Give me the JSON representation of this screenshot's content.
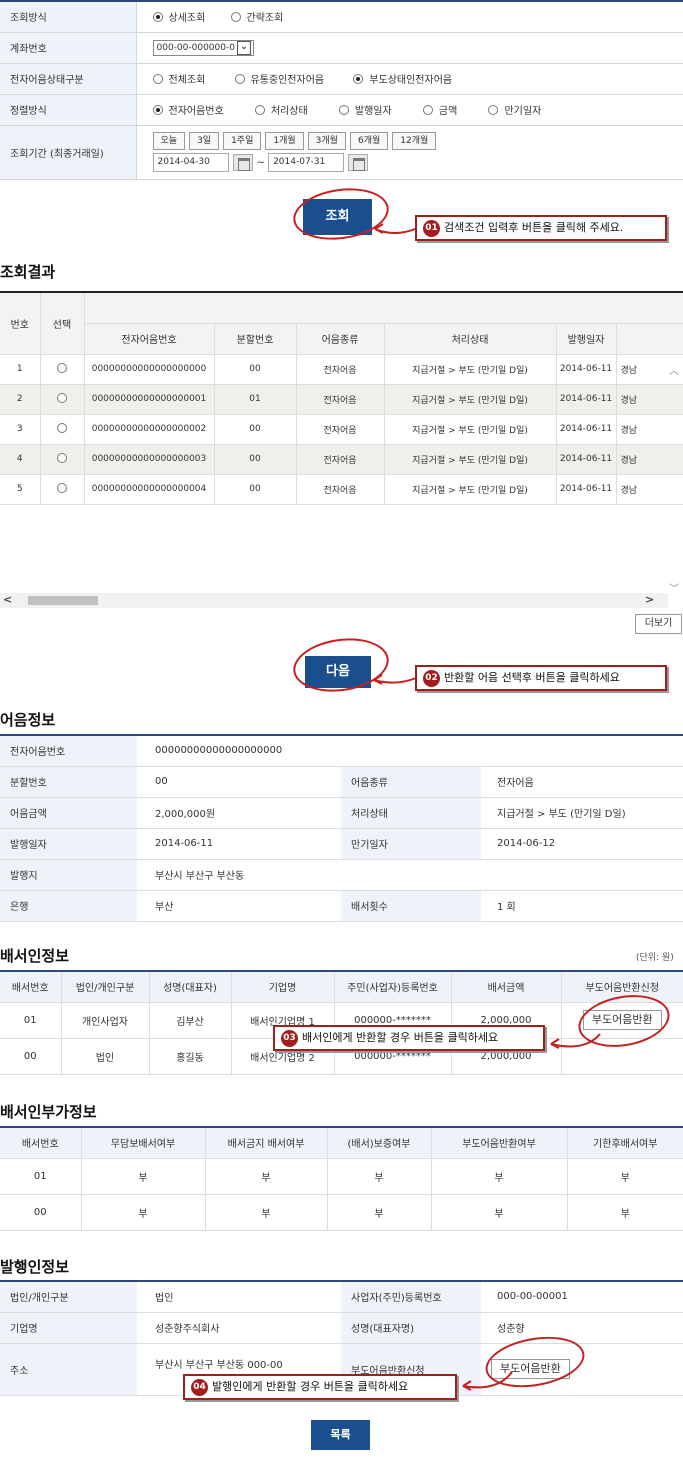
{
  "search_form": {
    "rows": [
      {
        "label": "조회방식",
        "options": [
          "상세조회",
          "간략조회"
        ],
        "selected": 0
      },
      {
        "label": "계좌번호",
        "account_value": "000-00-000000-0"
      },
      {
        "label": "전자어음상태구분",
        "options": [
          "전체조회",
          "유통중인전자어음",
          "부도상태인전자어음"
        ],
        "selected": 2
      },
      {
        "label": "정렬방식",
        "options": [
          "전자어음번호",
          "처리상태",
          "발행일자",
          "금액",
          "만기일자"
        ],
        "selected": 0
      },
      {
        "label": "조회기간 (최종거래일)",
        "periods": [
          "오늘",
          "3일",
          "1주일",
          "1개월",
          "3개월",
          "6개월",
          "12개월"
        ],
        "date_from": "2014-04-30",
        "date_sep": "~",
        "date_to": "2014-07-31"
      }
    ]
  },
  "search_button": "조회",
  "callouts": {
    "c1": {
      "num": "01",
      "text": "검색조건 입력후 버튼을 클릭해 주세요."
    },
    "c2": {
      "num": "02",
      "text": "반환할 어음 선택후 버튼을 클릭하세요"
    },
    "c3": {
      "num": "03",
      "text": "배서인에게 반환할 경우 버튼을 클릭하세요"
    },
    "c4": {
      "num": "04",
      "text": "발행인에게 반환할 경우 버튼을 클릭하세요"
    }
  },
  "results": {
    "title": "조회결과",
    "headers": [
      "번호",
      "선택",
      "전자어음번호",
      "분할번호",
      "어음종류",
      "처리상태",
      "발행일자"
    ],
    "rows": [
      {
        "no": "1",
        "note": "00000000000000000000",
        "split": "00",
        "kind": "전자어음",
        "status": "지급거절 > 부도 (만기일 D일)",
        "date": "2014-06-11",
        "extra": "경남"
      },
      {
        "no": "2",
        "note": "00000000000000000001",
        "split": "01",
        "kind": "전자어음",
        "status": "지급거절 > 부도 (만기일 D일)",
        "date": "2014-06-11",
        "extra": "경남"
      },
      {
        "no": "3",
        "note": "00000000000000000002",
        "split": "00",
        "kind": "전자어음",
        "status": "지급거절 > 부도 (만기일 D일)",
        "date": "2014-06-11",
        "extra": "경남"
      },
      {
        "no": "4",
        "note": "00000000000000000003",
        "split": "00",
        "kind": "전자어음",
        "status": "지급거절 > 부도 (만기일 D일)",
        "date": "2014-06-11",
        "extra": "경남"
      },
      {
        "no": "5",
        "note": "00000000000000000004",
        "split": "00",
        "kind": "전자어음",
        "status": "지급거절 > 부도 (만기일 D일)",
        "date": "2014-06-11",
        "extra": "경남"
      }
    ],
    "more_button": "더보기"
  },
  "next_button": "다음",
  "note_info": {
    "title": "어음정보",
    "note_no_label": "전자어음번호",
    "note_no": "00000000000000000000",
    "split_label": "분할번호",
    "split": "00",
    "kind_label": "어음종류",
    "kind": "전자어음",
    "amount_label": "어음금액",
    "amount": "2,000,000원",
    "status_label": "처리상태",
    "status": "지급거절 > 부도 (만기일 D일)",
    "issue_label": "발행일자",
    "issue": "2014-06-11",
    "due_label": "만기일자",
    "due": "2014-06-12",
    "place_label": "발행지",
    "place": "부산시 부산구 부산동",
    "bank_label": "은행",
    "bank": "부산",
    "endorse_count_label": "배서횟수",
    "endorse_count": "1 회"
  },
  "endorser_info": {
    "title": "배서인정보",
    "unit": "(단위: 원)",
    "headers": [
      "배서번호",
      "법인/개인구분",
      "성명(대표자)",
      "기업명",
      "주민(사업자)등록번호",
      "배서금액",
      "부도어음반환신청"
    ],
    "rows": [
      {
        "no": "01",
        "type": "개인사업자",
        "name": "김부산",
        "company": "배서인기업명 1",
        "reg": "000000-*******",
        "amount": "2,000,000",
        "action": "부도어음반환"
      },
      {
        "no": "00",
        "type": "법인",
        "name": "홍길동",
        "company": "배서인기업명 2",
        "reg": "000000-*******",
        "amount": "2,000,000",
        "action": ""
      }
    ]
  },
  "endorser_extra": {
    "title": "배서인부가정보",
    "headers": [
      "배서번호",
      "무담보배서여부",
      "배서금지 배서여부",
      "(배서)보증여부",
      "부도어음반환여부",
      "기한후배서여부"
    ],
    "rows": [
      [
        "01",
        "부",
        "부",
        "부",
        "부",
        "부"
      ],
      [
        "00",
        "부",
        "부",
        "부",
        "부",
        "부"
      ]
    ]
  },
  "issuer_info": {
    "title": "발행인정보",
    "type_label": "법인/개인구분",
    "type": "법인",
    "reg_label": "사업자(주민)등록번호",
    "reg": "000-00-00001",
    "company_label": "기업명",
    "company": "성춘향주식회사",
    "name_label": "성명(대표자명)",
    "name": "성춘향",
    "addr_label": "주소",
    "addr": "부산시 부산구 부산동 000-00",
    "return_label": "부도어음반환신청",
    "return_button": "부도어음반환"
  },
  "list_button": "목록",
  "colors": {
    "accent": "#1a4e8f",
    "callout": "#a31d1d",
    "header_bg": "#eef3f9"
  }
}
